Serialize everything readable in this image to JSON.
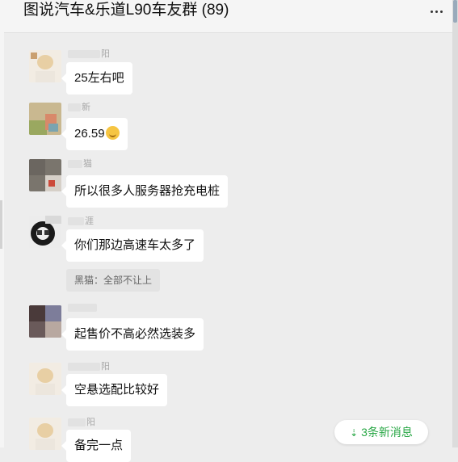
{
  "header": {
    "title": "图说汽车&乐道L90车友群 (89)"
  },
  "messages": [
    {
      "name_tail": "阳",
      "text": "25左右吧"
    },
    {
      "name_tail": "新",
      "text": "26.59",
      "has_emoji": true,
      "emoji_icon": "smile-emoji-icon"
    },
    {
      "name_tail": "猫",
      "text": "所以很多人服务器抢充电桩"
    },
    {
      "name_tail": "涯",
      "text": "你们那边高速车太多了",
      "quote": "黑猫：全部不让上"
    },
    {
      "name_tail": "",
      "text": "起售价不高必然选装多"
    },
    {
      "name_tail": "阳",
      "text": "空悬选配比较好"
    },
    {
      "name_tail": "阳",
      "text": "备完一点"
    }
  ],
  "new_messages": {
    "label": "3条新消息",
    "icon": "double-chevron-down-icon",
    "color": "#28a745"
  },
  "colors": {
    "background": "#ededed",
    "bubble": "#ffffff",
    "accent_green": "#28a745"
  }
}
